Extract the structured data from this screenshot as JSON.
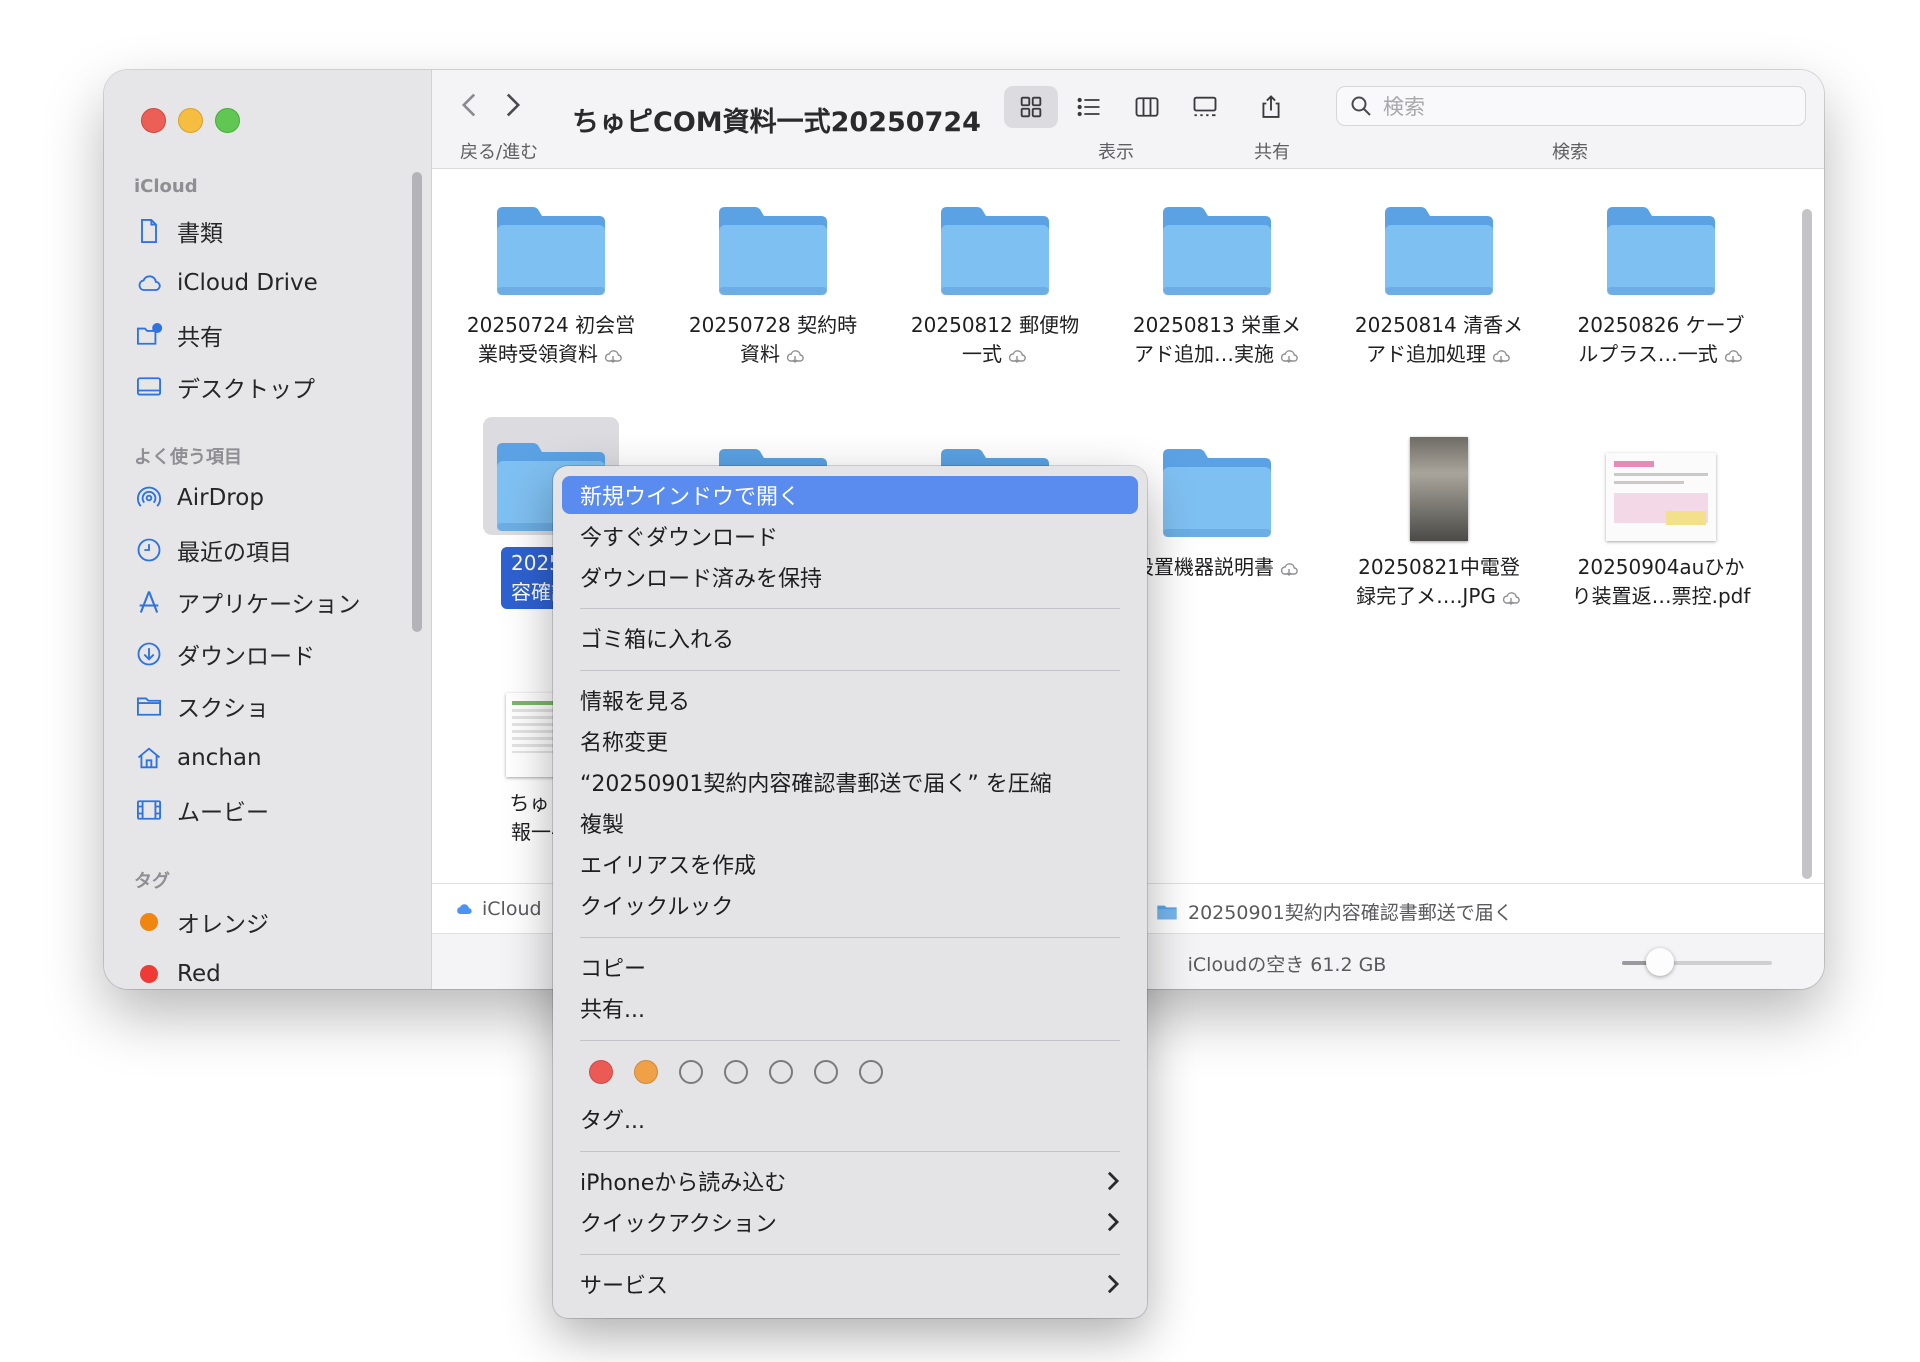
{
  "window": {
    "title": "ちゅピCOM資料一式20250724",
    "toolbar": {
      "back_forward_label": "戻る/進む",
      "view_label": "表示",
      "share_label": "共有",
      "search_label": "検索",
      "search_placeholder": "検索"
    }
  },
  "sidebar": {
    "section_icloud": "iCloud",
    "icloud_items": [
      {
        "label": "書類",
        "icon": "document-icon"
      },
      {
        "label": "iCloud Drive",
        "icon": "cloud-icon"
      },
      {
        "label": "共有",
        "icon": "shared-folder-icon"
      },
      {
        "label": "デスクトップ",
        "icon": "desktop-icon"
      }
    ],
    "section_favorites": "よく使う項目",
    "favorite_items": [
      {
        "label": "AirDrop",
        "icon": "airdrop-icon"
      },
      {
        "label": "最近の項目",
        "icon": "clock-icon"
      },
      {
        "label": "アプリケーション",
        "icon": "applications-icon"
      },
      {
        "label": "ダウンロード",
        "icon": "download-icon"
      },
      {
        "label": "スクショ",
        "icon": "folder-icon"
      },
      {
        "label": "anchan",
        "icon": "home-icon"
      },
      {
        "label": "ムービー",
        "icon": "film-icon"
      }
    ],
    "section_tags": "タグ",
    "tag_items": [
      {
        "label": "オレンジ",
        "color": "#f0850f"
      },
      {
        "label": "Red",
        "color": "#f03a35"
      }
    ]
  },
  "files": {
    "row1": [
      {
        "line1": "20250724 初会営",
        "line2": "業時受領資料"
      },
      {
        "line1": "20250728 契約時",
        "line2": "資料"
      },
      {
        "line1": "20250812 郵便物",
        "line2": "一式"
      },
      {
        "line1": "20250813 栄重メ",
        "line2": "アド追加…実施"
      },
      {
        "line1": "20250814 清香メ",
        "line2": "アド追加処理"
      },
      {
        "line1": "20250826 ケーブ",
        "line2": "ルプラス…一式"
      }
    ],
    "row2": [
      {
        "line1": "202509",
        "line2": "容確認書"
      },
      {
        "line1": "",
        "line2": ""
      },
      {
        "line1": "",
        "line2": ""
      },
      {
        "line1": "設置機器説明書",
        "line2": ""
      },
      {
        "line1": "20250821中電登",
        "line2": "録完了メ….JPG"
      },
      {
        "line1": "20250904auひか",
        "line2": "り装置返…票控.pdf"
      }
    ],
    "row3": [
      {
        "line1": "ちゅピco",
        "line2": "報一手続"
      }
    ]
  },
  "pathbar": {
    "root": "iCloud",
    "current": "20250901契約内容確認書郵送で届く"
  },
  "statusbar": {
    "free_space": "iCloudの空き 61.2 GB",
    "zoom_level": 0.2
  },
  "context_menu": {
    "open_new_window": "新規ウインドウで開く",
    "download_now": "今すぐダウンロード",
    "keep_downloaded": "ダウンロード済みを保持",
    "move_to_trash": "ゴミ箱に入れる",
    "get_info": "情報を見る",
    "rename": "名称変更",
    "compress": "“20250901契約内容確認書郵送で届く” を圧縮",
    "duplicate": "複製",
    "make_alias": "エイリアスを作成",
    "quick_look": "クイックルック",
    "copy": "コピー",
    "share": "共有...",
    "tag_colors": [
      "#ec5a55",
      "#f0a148",
      "none",
      "none",
      "none",
      "none",
      "none"
    ],
    "tags": "タグ...",
    "import_from_iphone": "iPhoneから読み込む",
    "quick_actions": "クイックアクション",
    "services": "サービス"
  }
}
